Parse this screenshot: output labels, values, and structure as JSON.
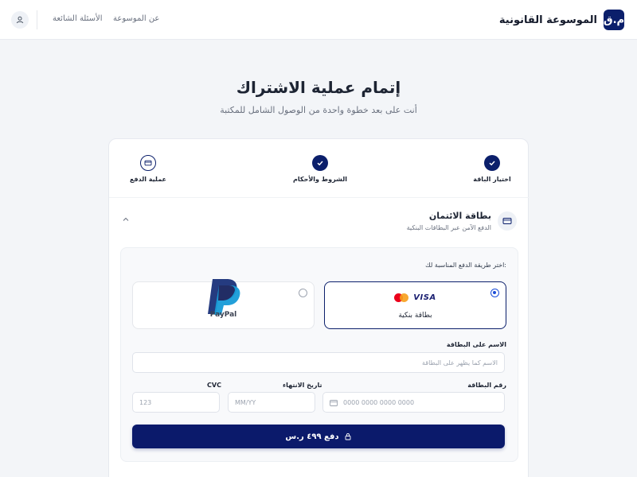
{
  "header": {
    "brand_logo_text": "م.ق",
    "brand_name": "الموسوعة القانونية",
    "nav_about": "عن الموسوعة",
    "nav_faq": "الأسئلة الشائعة"
  },
  "page": {
    "title": "إتمام عملية الاشتراك",
    "subtitle": "أنت على بعد خطوة واحدة من الوصول الشامل للمكتبة"
  },
  "steps": [
    {
      "label": "اختيار الباقة",
      "state": "done"
    },
    {
      "label": "الشروط والأحكام",
      "state": "done"
    },
    {
      "label": "عملية الدفع",
      "state": "current"
    }
  ],
  "section": {
    "title": "بطاقة الائتمان",
    "subtitle": "الدفع الآمن عبر البطاقات البنكية"
  },
  "payment": {
    "choose_label": "اختر طريقة الدفع المناسبة لك:",
    "methods": [
      {
        "label": "بطاقة بنكية",
        "selected": true,
        "logos": [
          "mastercard-logo",
          "VISA"
        ]
      },
      {
        "label": "PayPal",
        "selected": false
      }
    ],
    "fields": {
      "name_label": "الاسم على البطاقة",
      "name_placeholder": "الاسم كما يظهر على البطاقة",
      "card_label": "رقم البطاقة",
      "card_placeholder": "0000 0000 0000 0000",
      "expiry_label": "تاريخ الانتهاء",
      "expiry_placeholder": "MM/YY",
      "cvc_label": "CVC",
      "cvc_placeholder": "123"
    },
    "pay_button": "دفع ٤٩٩ ر.س"
  },
  "colors": {
    "primary": "#0b1f6b",
    "accent": "#1d4ed8"
  }
}
